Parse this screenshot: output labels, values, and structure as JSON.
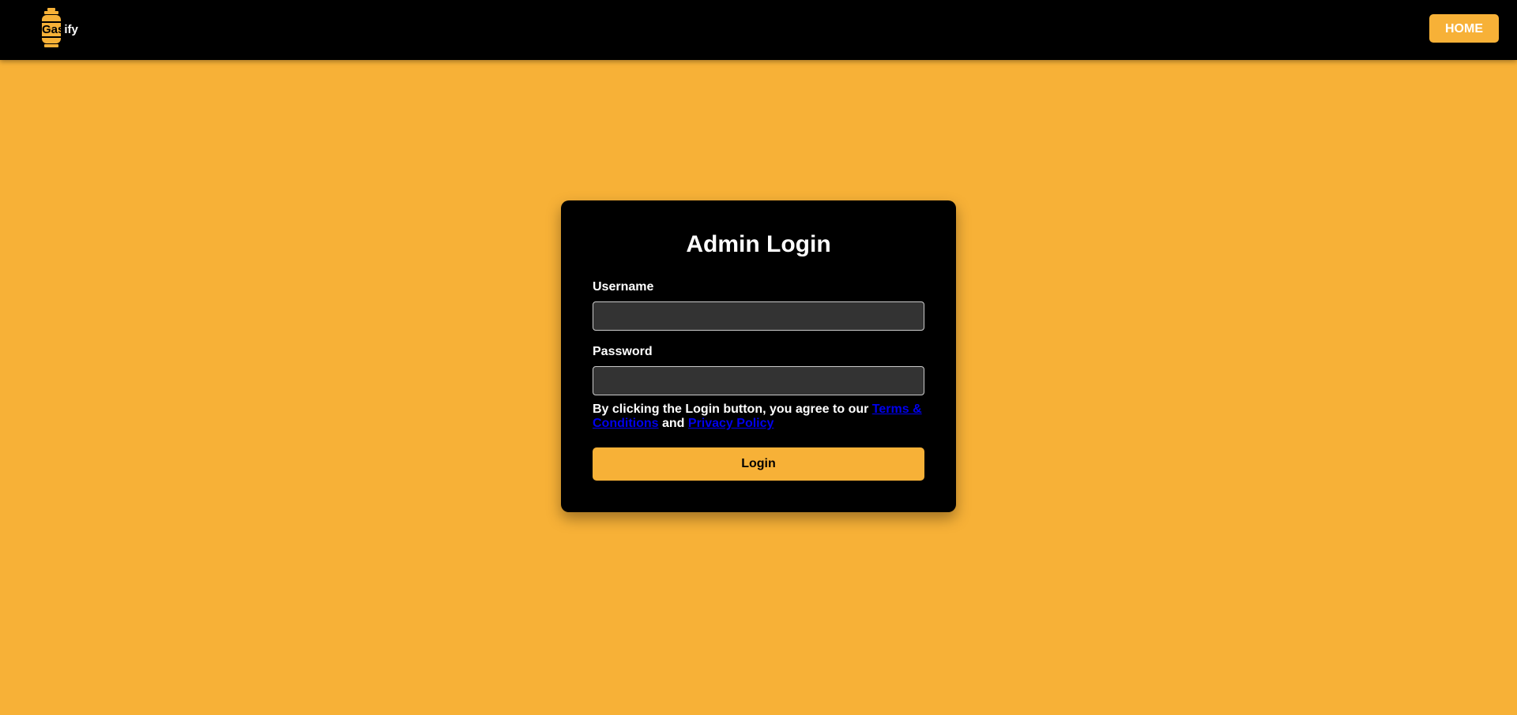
{
  "nav": {
    "logo_prefix": "Gas",
    "logo_suffix": "ify",
    "logo_icon": "gas-cylinder-icon",
    "home_label": "HOME"
  },
  "login": {
    "title": "Admin Login",
    "username_label": "Username",
    "username_value": "",
    "password_label": "Password",
    "password_value": "",
    "terms_prefix": "By clicking the Login button, you agree to our ",
    "terms_link": "Terms & Conditions",
    "terms_middle": " and ",
    "privacy_link": "Privacy Policy",
    "login_label": "Login"
  },
  "colors": {
    "accent": "#F7B137",
    "navbar": "#000000",
    "card": "#000000",
    "input_bg": "#333333",
    "link": "#0000EE"
  }
}
